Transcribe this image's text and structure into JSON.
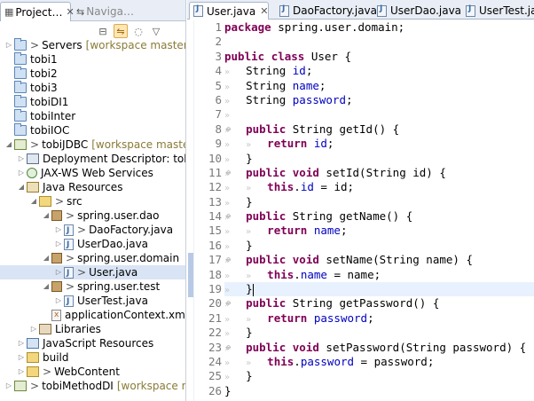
{
  "left_panel": {
    "tabs": [
      {
        "label": "Project…",
        "close": "✕"
      },
      {
        "label": "Naviga…"
      }
    ],
    "tree": [
      {
        "indent": 0,
        "twisty": "closed",
        "icon": "project",
        "prefix": ">",
        "label": "Servers",
        "decoration": "[workspace master]"
      },
      {
        "indent": 0,
        "twisty": "",
        "icon": "project",
        "label": "tobi1"
      },
      {
        "indent": 0,
        "twisty": "",
        "icon": "project",
        "label": "tobi2"
      },
      {
        "indent": 0,
        "twisty": "",
        "icon": "project",
        "label": "tobi3"
      },
      {
        "indent": 0,
        "twisty": "",
        "icon": "project",
        "label": "tobiDI1"
      },
      {
        "indent": 0,
        "twisty": "",
        "icon": "project",
        "label": "tobiInter"
      },
      {
        "indent": 0,
        "twisty": "",
        "icon": "project",
        "label": "tobiIOC"
      },
      {
        "indent": 0,
        "twisty": "open",
        "icon": "webproject",
        "prefix": ">",
        "label": "tobiJDBC",
        "decoration": "[workspace master]"
      },
      {
        "indent": 1,
        "twisty": "closed",
        "icon": "descriptor",
        "label": "Deployment Descriptor: tobiJDBC"
      },
      {
        "indent": 1,
        "twisty": "closed",
        "icon": "webservice",
        "label": "JAX-WS Web Services"
      },
      {
        "indent": 1,
        "twisty": "open",
        "icon": "javaresources",
        "label": "Java Resources"
      },
      {
        "indent": 2,
        "twisty": "open",
        "icon": "srcfolder",
        "prefix": ">",
        "label": "src"
      },
      {
        "indent": 3,
        "twisty": "open",
        "icon": "package",
        "prefix": ">",
        "label": "spring.user.dao"
      },
      {
        "indent": 4,
        "twisty": "closed",
        "icon": "java",
        "prefix": ">",
        "label": "DaoFactory.java"
      },
      {
        "indent": 4,
        "twisty": "closed",
        "icon": "java",
        "label": "UserDao.java"
      },
      {
        "indent": 3,
        "twisty": "open",
        "icon": "package",
        "prefix": ">",
        "label": "spring.user.domain"
      },
      {
        "indent": 4,
        "twisty": "closed",
        "icon": "java",
        "prefix": ">",
        "label": "User.java",
        "selected": true
      },
      {
        "indent": 3,
        "twisty": "open",
        "icon": "package",
        "prefix": ">",
        "label": "spring.user.test"
      },
      {
        "indent": 4,
        "twisty": "closed",
        "icon": "java",
        "label": "UserTest.java"
      },
      {
        "indent": 3,
        "twisty": "",
        "icon": "xml",
        "label": "applicationContext.xml"
      },
      {
        "indent": 2,
        "twisty": "closed",
        "icon": "library",
        "label": "Libraries"
      },
      {
        "indent": 1,
        "twisty": "closed",
        "icon": "javascript",
        "label": "JavaScript Resources"
      },
      {
        "indent": 1,
        "twisty": "closed",
        "icon": "folder",
        "label": "build"
      },
      {
        "indent": 1,
        "twisty": "closed",
        "icon": "folder",
        "prefix": ">",
        "label": "WebContent"
      },
      {
        "indent": 0,
        "twisty": "closed",
        "icon": "webproject",
        "prefix": ">",
        "label": "tobiMethodDI",
        "decoration": "[workspace master]"
      }
    ]
  },
  "editor": {
    "tabs": [
      {
        "label": "User.java",
        "close": "✕",
        "active": true
      },
      {
        "label": "DaoFactory.java"
      },
      {
        "label": "UserDao.java"
      },
      {
        "label": "UserTest.java"
      }
    ],
    "current_line": 19,
    "changed_lines": [
      17,
      18,
      19
    ],
    "lines": [
      {
        "n": "1",
        "code": [
          [
            "kw",
            "package"
          ],
          [
            "t",
            " spring.user.domain;"
          ]
        ]
      },
      {
        "n": "2",
        "code": []
      },
      {
        "n": "3",
        "code": [
          [
            "kw",
            "public"
          ],
          [
            "t",
            " "
          ],
          [
            "kw",
            "class"
          ],
          [
            "t",
            " User {"
          ]
        ]
      },
      {
        "n": "4",
        "code": [
          [
            "ws",
            "»   "
          ],
          [
            "t",
            "String "
          ],
          [
            "fld",
            "id"
          ],
          [
            "t",
            ";"
          ]
        ]
      },
      {
        "n": "5",
        "code": [
          [
            "ws",
            "»   "
          ],
          [
            "t",
            "String "
          ],
          [
            "fld",
            "name"
          ],
          [
            "t",
            ";"
          ]
        ]
      },
      {
        "n": "6",
        "code": [
          [
            "ws",
            "»   "
          ],
          [
            "t",
            "String "
          ],
          [
            "fld",
            "password"
          ],
          [
            "t",
            ";"
          ]
        ]
      },
      {
        "n": "7",
        "code": [
          [
            "ws",
            "»   "
          ]
        ]
      },
      {
        "n": "8",
        "fold": "⊖",
        "code": [
          [
            "ws",
            "»   "
          ],
          [
            "kw",
            "public"
          ],
          [
            "t",
            " String getId() {"
          ]
        ]
      },
      {
        "n": "9",
        "code": [
          [
            "ws",
            "»   »   "
          ],
          [
            "kw",
            "return"
          ],
          [
            "t",
            " "
          ],
          [
            "fld",
            "id"
          ],
          [
            "t",
            ";"
          ]
        ]
      },
      {
        "n": "10",
        "code": [
          [
            "ws",
            "»   "
          ],
          [
            "t",
            "}"
          ]
        ]
      },
      {
        "n": "11",
        "fold": "⊖",
        "code": [
          [
            "ws",
            "»   "
          ],
          [
            "kw",
            "public"
          ],
          [
            "t",
            " "
          ],
          [
            "kw",
            "void"
          ],
          [
            "t",
            " setId(String id) {"
          ]
        ]
      },
      {
        "n": "12",
        "code": [
          [
            "ws",
            "»   »   "
          ],
          [
            "kw",
            "this"
          ],
          [
            "t",
            "."
          ],
          [
            "fld",
            "id"
          ],
          [
            "t",
            " = id;"
          ]
        ]
      },
      {
        "n": "13",
        "code": [
          [
            "ws",
            "»   "
          ],
          [
            "t",
            "}"
          ]
        ]
      },
      {
        "n": "14",
        "fold": "⊖",
        "code": [
          [
            "ws",
            "»   "
          ],
          [
            "kw",
            "public"
          ],
          [
            "t",
            " String getName() {"
          ]
        ]
      },
      {
        "n": "15",
        "code": [
          [
            "ws",
            "»   »   "
          ],
          [
            "kw",
            "return"
          ],
          [
            "t",
            " "
          ],
          [
            "fld",
            "name"
          ],
          [
            "t",
            ";"
          ]
        ]
      },
      {
        "n": "16",
        "code": [
          [
            "ws",
            "»   "
          ],
          [
            "t",
            "}"
          ]
        ]
      },
      {
        "n": "17",
        "fold": "⊖",
        "code": [
          [
            "ws",
            "»   "
          ],
          [
            "kw",
            "public"
          ],
          [
            "t",
            " "
          ],
          [
            "kw",
            "void"
          ],
          [
            "t",
            " setName(String name) {"
          ]
        ]
      },
      {
        "n": "18",
        "code": [
          [
            "ws",
            "»   »   "
          ],
          [
            "kw",
            "this"
          ],
          [
            "t",
            "."
          ],
          [
            "fld",
            "name"
          ],
          [
            "t",
            " = name;"
          ]
        ]
      },
      {
        "n": "19",
        "code": [
          [
            "ws",
            "»   "
          ],
          [
            "t",
            "}"
          ],
          [
            "caret",
            ""
          ]
        ]
      },
      {
        "n": "20",
        "fold": "⊖",
        "code": [
          [
            "ws",
            "»   "
          ],
          [
            "kw",
            "public"
          ],
          [
            "t",
            " String getPassword() {"
          ]
        ]
      },
      {
        "n": "21",
        "code": [
          [
            "ws",
            "»   »   "
          ],
          [
            "kw",
            "return"
          ],
          [
            "t",
            " "
          ],
          [
            "fld",
            "password"
          ],
          [
            "t",
            ";"
          ]
        ]
      },
      {
        "n": "22",
        "code": [
          [
            "ws",
            "»   "
          ],
          [
            "t",
            "}"
          ]
        ]
      },
      {
        "n": "23",
        "fold": "⊖",
        "code": [
          [
            "ws",
            "»   "
          ],
          [
            "kw",
            "public"
          ],
          [
            "t",
            " "
          ],
          [
            "kw",
            "void"
          ],
          [
            "t",
            " setPassword(String password) {"
          ]
        ]
      },
      {
        "n": "24",
        "code": [
          [
            "ws",
            "»   »   "
          ],
          [
            "kw",
            "this"
          ],
          [
            "t",
            "."
          ],
          [
            "fld",
            "password"
          ],
          [
            "t",
            " = password;"
          ]
        ]
      },
      {
        "n": "25",
        "code": [
          [
            "ws",
            "»   "
          ],
          [
            "t",
            "}"
          ]
        ]
      },
      {
        "n": "26",
        "code": [
          [
            "t",
            "}"
          ]
        ]
      }
    ]
  }
}
